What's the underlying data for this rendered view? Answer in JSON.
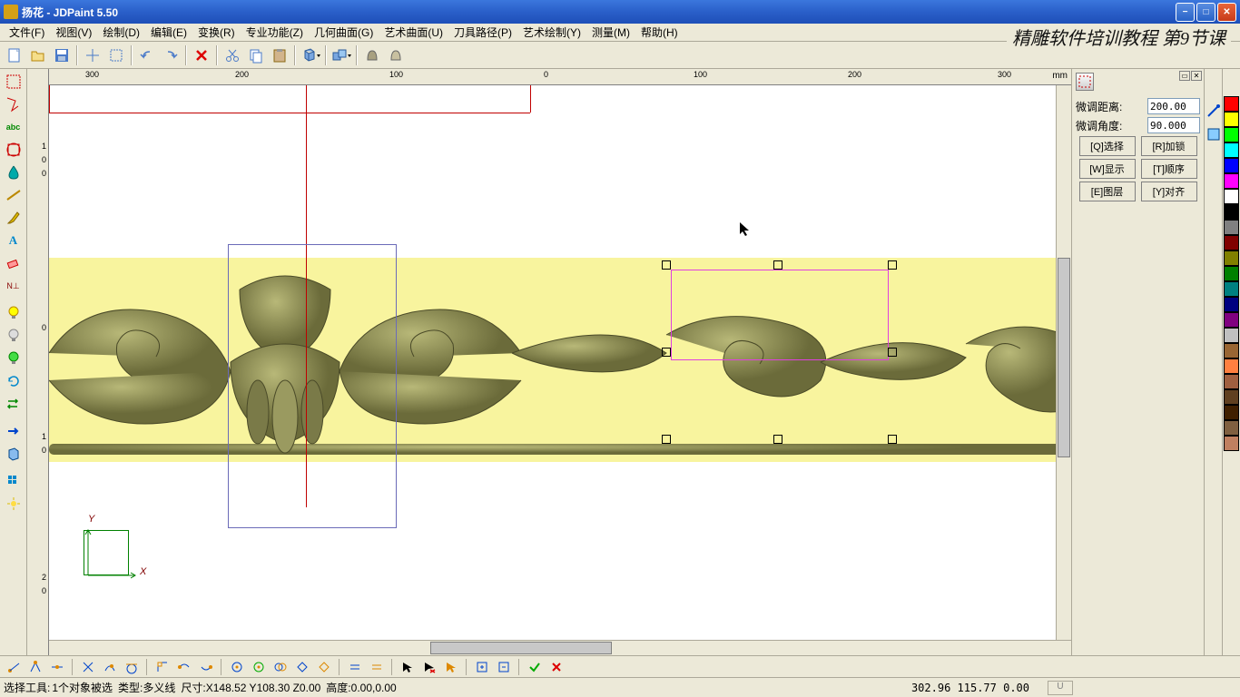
{
  "title": "扬花 - JDPaint 5.50",
  "menus": [
    "文件(F)",
    "视图(V)",
    "绘制(D)",
    "编辑(E)",
    "变换(R)",
    "专业功能(Z)",
    "几何曲面(G)",
    "艺术曲面(U)",
    "刀具路径(P)",
    "艺术绘制(Y)",
    "测量(M)",
    "帮助(H)"
  ],
  "training_banner": "精雕软件培训教程 第9节课",
  "ruler": {
    "unit": "mm",
    "ticks": [
      "300",
      "200",
      "100",
      "0",
      "100",
      "200",
      "300"
    ]
  },
  "v_ruler": [
    "1",
    "0",
    "0",
    "0",
    "1",
    "0",
    "2",
    "0"
  ],
  "right_panel": {
    "dist_label": "微调距离:",
    "dist_value": "200.00",
    "angle_label": "微调角度:",
    "angle_value": "90.000",
    "buttons": [
      [
        "[Q]选择",
        "[R]加锁"
      ],
      [
        "[W]显示",
        "[T]顺序"
      ],
      [
        "[E]图层",
        "[Y]对齐"
      ]
    ]
  },
  "palette": [
    "#FF0000",
    "#FFFF00",
    "#00FF00",
    "#00FFFF",
    "#0000FF",
    "#FF00FF",
    "#FFFFFF",
    "#000000",
    "#808080",
    "#800000",
    "#808000",
    "#008000",
    "#008080",
    "#000080",
    "#800080",
    "#C0C0C0",
    "#996633",
    "#FF8040",
    "#A06040",
    "#604020",
    "#402000",
    "#806040",
    "#C08060"
  ],
  "status": {
    "tool": "选择工具:",
    "sel": "1个对象被选",
    "type_label": "类型:",
    "type": "多义线",
    "size_label": "尺寸:",
    "size": "X148.52 Y108.30 Z0.00",
    "height_label": "高度:",
    "height": "0.00,0.00",
    "coords": "302.96 115.77 0.00",
    "u_btn": "U"
  },
  "axis": {
    "x": "X",
    "y": "Y"
  },
  "toolbar_icons": [
    "new",
    "open",
    "save",
    "cursor",
    "marquee",
    "undo",
    "redo",
    "delete",
    "cut",
    "copy",
    "paste",
    "cube",
    "cubes",
    "render1",
    "render2"
  ],
  "left_tools": [
    "select-rect",
    "select-poly",
    "measure-text",
    "layer-circle",
    "paint-drop",
    "paint-line",
    "brush",
    "text-A",
    "erase",
    "snap",
    "bulb-blue",
    "bulb-off",
    "bulb-green",
    "refresh",
    "swap",
    "arrow-right",
    "3d-box",
    "grid",
    "spark"
  ],
  "bottom_tools": [
    "snap1",
    "snap2",
    "snap3",
    "snap4",
    "snap5",
    "snap6",
    "snap7",
    "snap8",
    "snap9",
    "snap10",
    "snap11",
    "snap12",
    "snap13",
    "snap14",
    "snap15",
    "snap16",
    "snap17",
    "snap18",
    "snap19",
    "snap20",
    "snap21",
    "snap22",
    "snap23",
    "snap24"
  ]
}
